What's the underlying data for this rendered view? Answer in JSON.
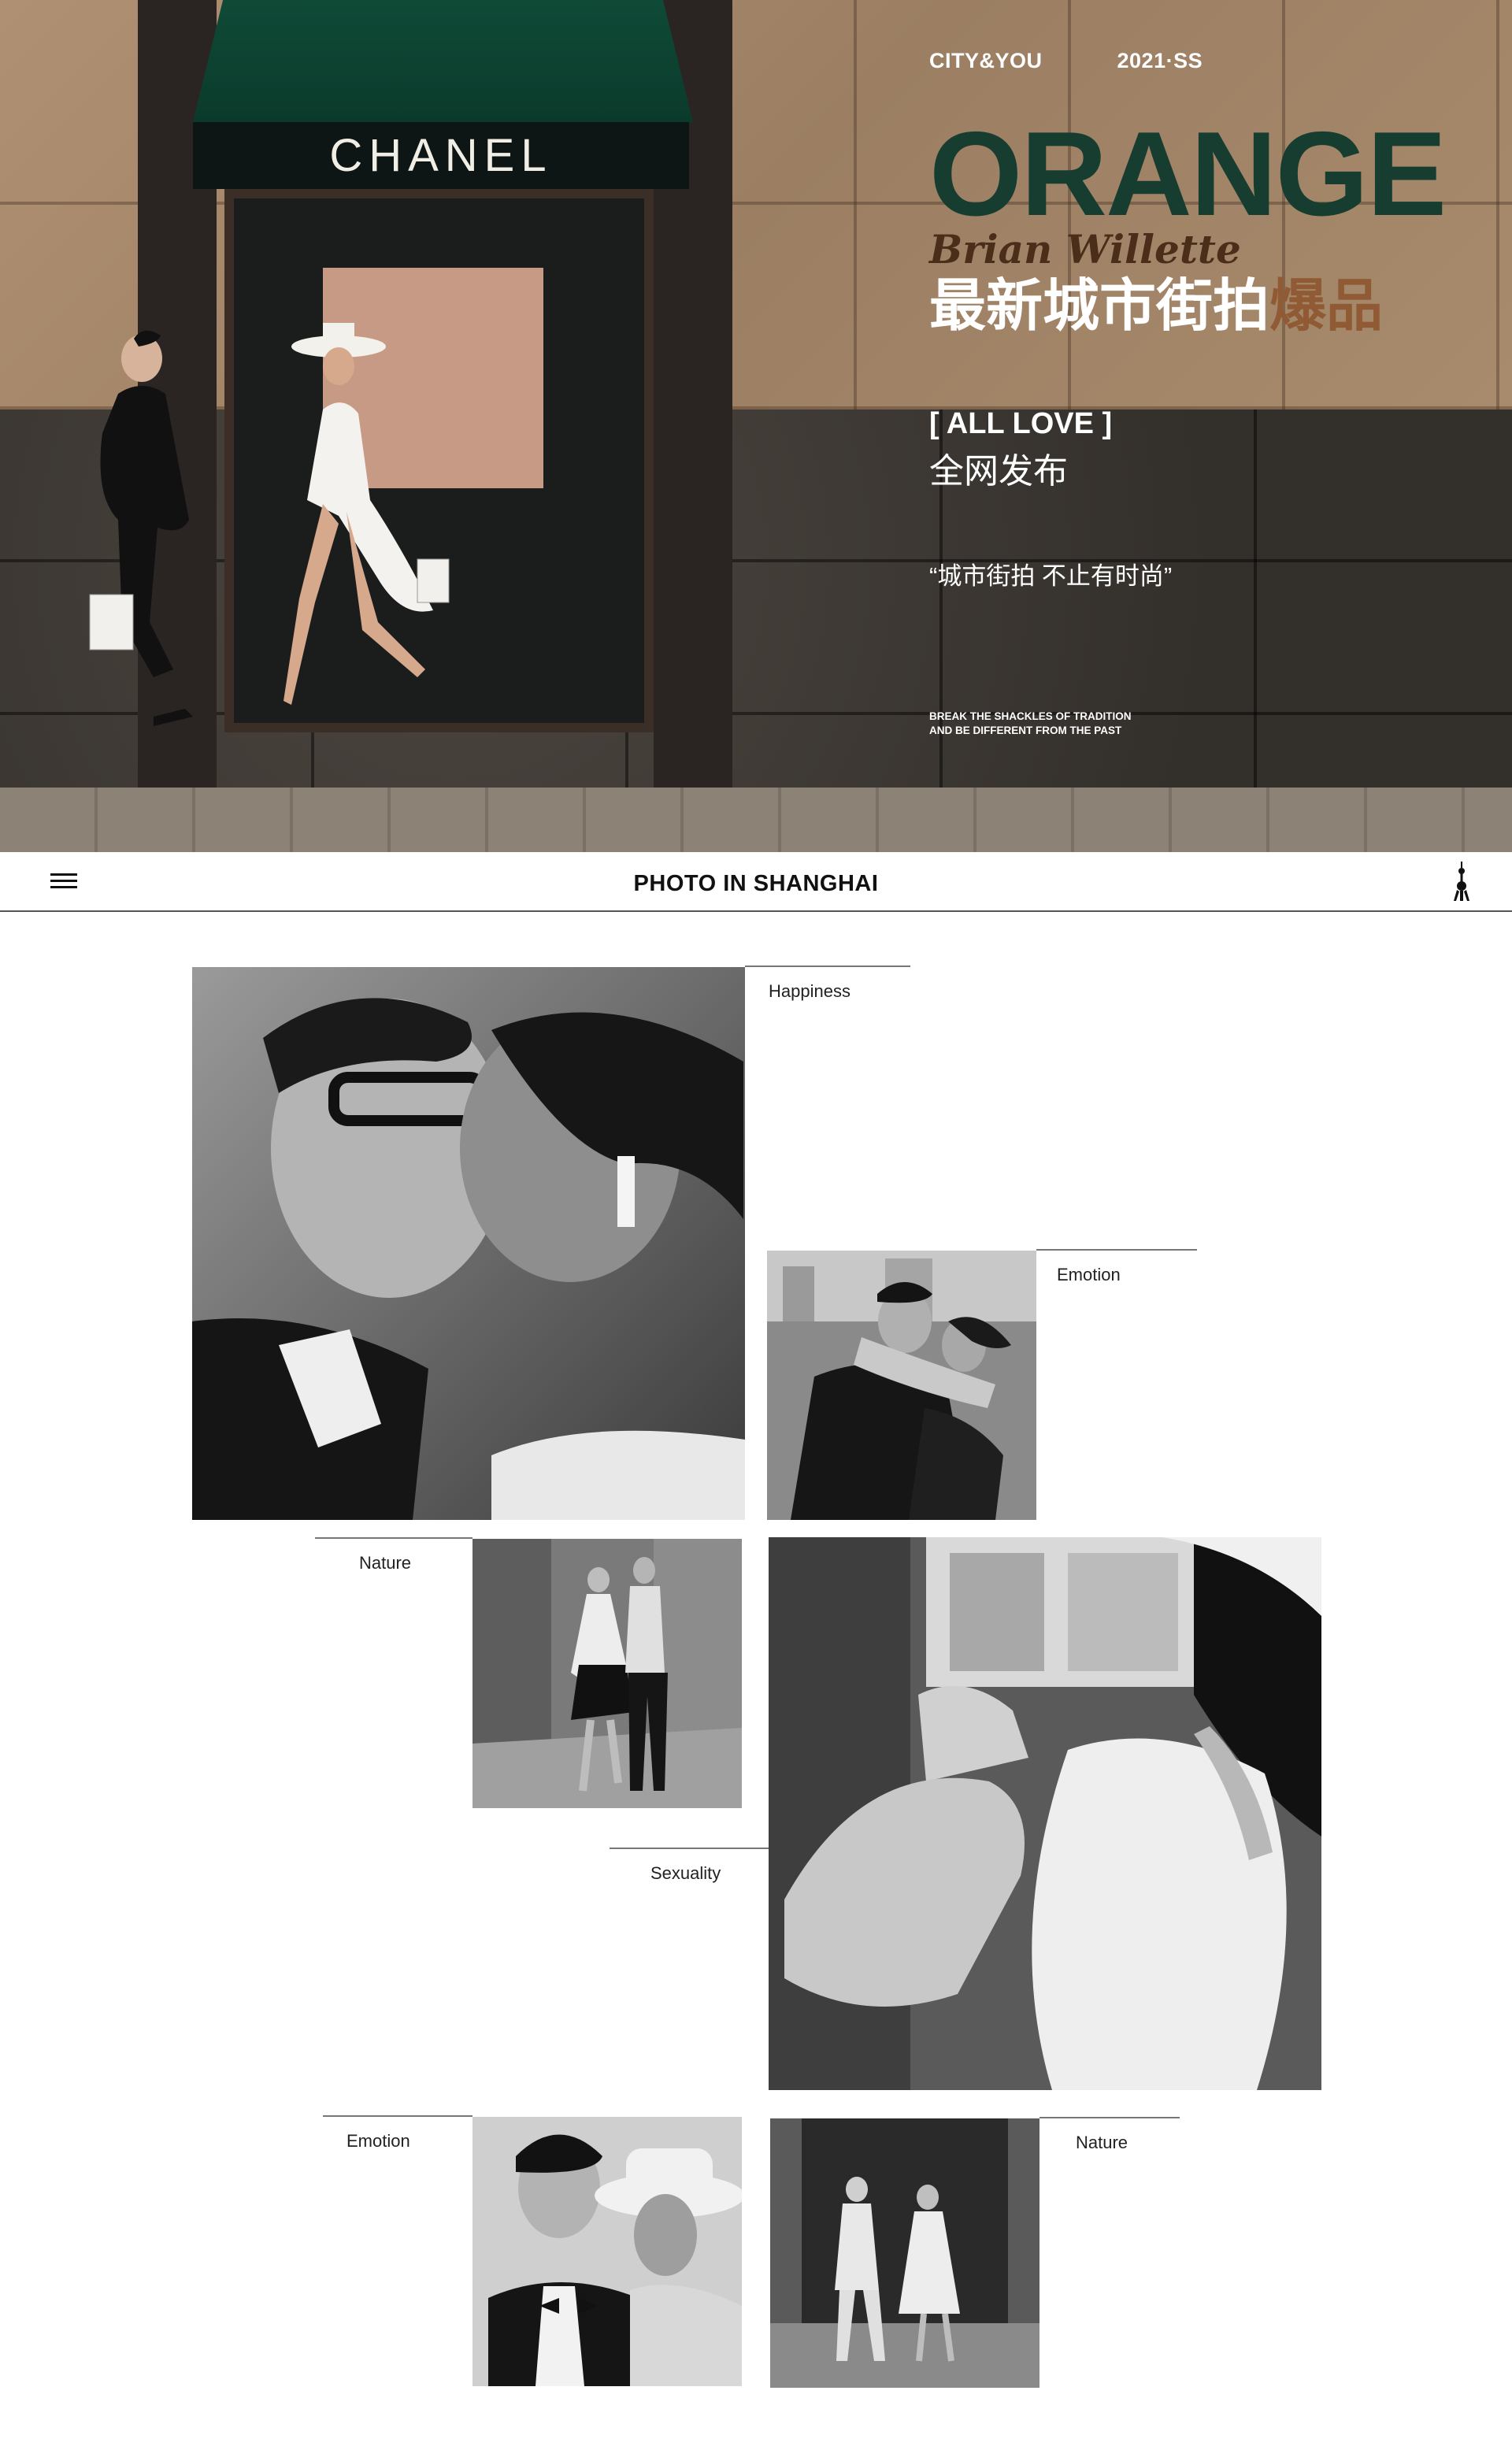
{
  "hero": {
    "store_sign": "CHANEL",
    "tag_left": "CITY&YOU",
    "tag_right": "2021·SS",
    "brand": "ORANGE",
    "author": "Brian Willette",
    "headline_main": "最新城市街拍",
    "headline_accent": "爆品",
    "all_love": "[ ALL LOVE ]",
    "release": "全网发布",
    "quote": "“城市街拍 不止有时尚”",
    "motto": "BREAK THE SHACKLES OF TRADITION AND BE DIFFERENT FROM THE PAST",
    "colors": {
      "brand_green": "#173d30",
      "accent_brown": "#8f5a34"
    }
  },
  "nav": {
    "menu_icon": "hamburger-menu-icon",
    "title": "PHOTO IN SHANGHAI",
    "right_icon": "oriental-pearl-tower-icon"
  },
  "gallery": {
    "labels": [
      "Happiness",
      "Emotion",
      "Nature",
      "Sexuality",
      "Emotion",
      "Nature"
    ]
  }
}
